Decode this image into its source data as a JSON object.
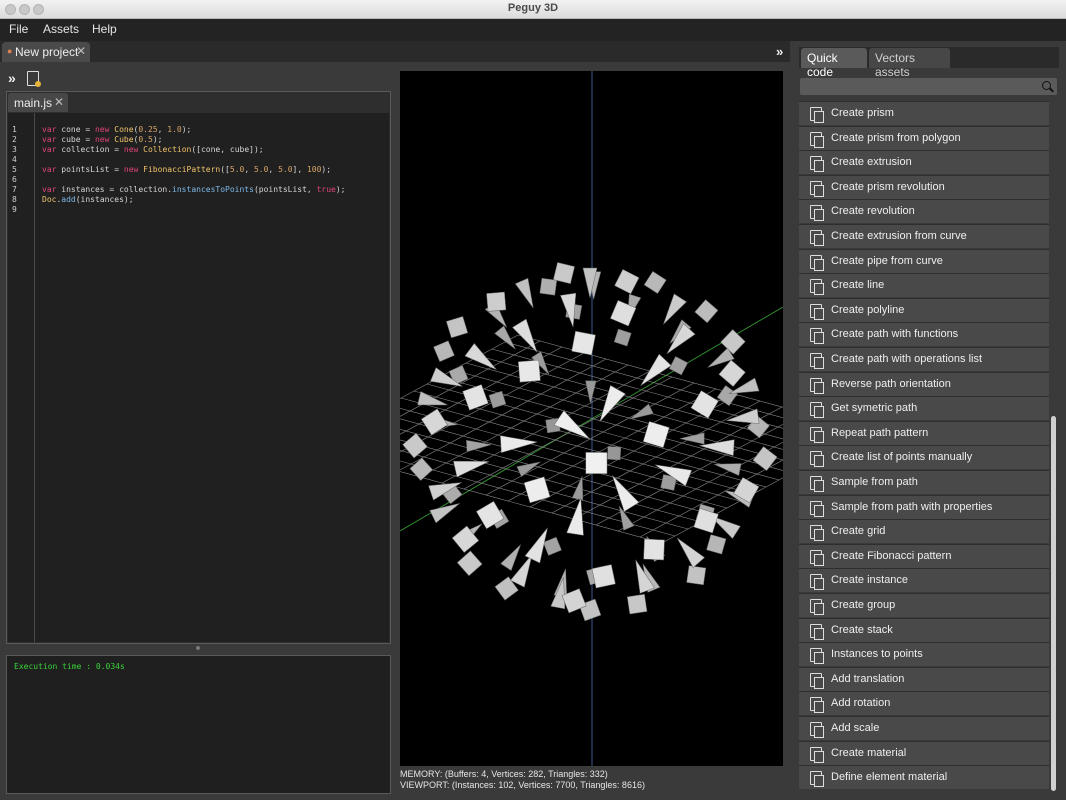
{
  "window": {
    "title": "Peguy 3D"
  },
  "menu": [
    "File",
    "Assets",
    "Help"
  ],
  "project_tab": {
    "label": "New project"
  },
  "editor": {
    "file_tab": "main.js",
    "lines": [
      {
        "n": "1",
        "parts": [
          {
            "t": "var",
            "c": "kw"
          },
          {
            "t": " cone = "
          },
          {
            "t": "new",
            "c": "kw"
          },
          {
            "t": " "
          },
          {
            "t": "Cone",
            "c": "cls"
          },
          {
            "t": "("
          },
          {
            "t": "0.25",
            "c": "num"
          },
          {
            "t": ", "
          },
          {
            "t": "1.0",
            "c": "num"
          },
          {
            "t": ");"
          }
        ]
      },
      {
        "n": "2",
        "parts": [
          {
            "t": "var",
            "c": "kw"
          },
          {
            "t": " cube = "
          },
          {
            "t": "new",
            "c": "kw"
          },
          {
            "t": " "
          },
          {
            "t": "Cube",
            "c": "cls"
          },
          {
            "t": "("
          },
          {
            "t": "0.5",
            "c": "num"
          },
          {
            "t": ");"
          }
        ]
      },
      {
        "n": "3",
        "parts": [
          {
            "t": "var",
            "c": "kw"
          },
          {
            "t": " collection = "
          },
          {
            "t": "new",
            "c": "kw"
          },
          {
            "t": " "
          },
          {
            "t": "Collection",
            "c": "cls"
          },
          {
            "t": "([cone, cube]);"
          }
        ]
      },
      {
        "n": "4",
        "parts": []
      },
      {
        "n": "5",
        "parts": [
          {
            "t": "var",
            "c": "kw"
          },
          {
            "t": " pointsList = "
          },
          {
            "t": "new",
            "c": "kw"
          },
          {
            "t": " "
          },
          {
            "t": "FibonacciPattern",
            "c": "cls"
          },
          {
            "t": "(["
          },
          {
            "t": "5.0",
            "c": "num"
          },
          {
            "t": ", "
          },
          {
            "t": "5.0",
            "c": "num"
          },
          {
            "t": ", "
          },
          {
            "t": "5.0",
            "c": "num"
          },
          {
            "t": "], "
          },
          {
            "t": "100",
            "c": "num"
          },
          {
            "t": ");"
          }
        ]
      },
      {
        "n": "6",
        "parts": []
      },
      {
        "n": "7",
        "parts": [
          {
            "t": "var",
            "c": "kw"
          },
          {
            "t": " instances = collection."
          },
          {
            "t": "instancesToPoints",
            "c": "fn"
          },
          {
            "t": "(pointsList, "
          },
          {
            "t": "true",
            "c": "kw"
          },
          {
            "t": ");"
          }
        ]
      },
      {
        "n": "8",
        "parts": [
          {
            "t": "Doc",
            "c": "cls"
          },
          {
            "t": "."
          },
          {
            "t": "add",
            "c": "fn"
          },
          {
            "t": "(instances);"
          }
        ]
      },
      {
        "n": "9",
        "parts": []
      }
    ]
  },
  "console": {
    "text": "Execution time : 0.034s"
  },
  "viewport": {
    "memory": "MEMORY: (Buffers: 4, Vertices: 282, Triangles: 332)",
    "stats": "VIEWPORT: (Instances: 102, Vertices: 7700, Triangles: 8616)"
  },
  "right_panel": {
    "tabs": [
      "Quick code",
      "Vectors assets"
    ],
    "search_placeholder": "",
    "items": [
      "Create prism",
      "Create prism from polygon",
      "Create extrusion",
      "Create prism revolution",
      "Create revolution",
      "Create extrusion from curve",
      "Create pipe from curve",
      "Create line",
      "Create polyline",
      "Create path with functions",
      "Create path with operations list",
      "Reverse path orientation",
      "Get symetric path",
      "Repeat path pattern",
      "Create list of points manually",
      "Sample from path",
      "Sample from path with properties",
      "Create grid",
      "Create Fibonacci pattern",
      "Create instance",
      "Create group",
      "Create stack",
      "Instances to points",
      "Add translation",
      "Add rotation",
      "Add scale",
      "Create material",
      "Define element material"
    ]
  }
}
